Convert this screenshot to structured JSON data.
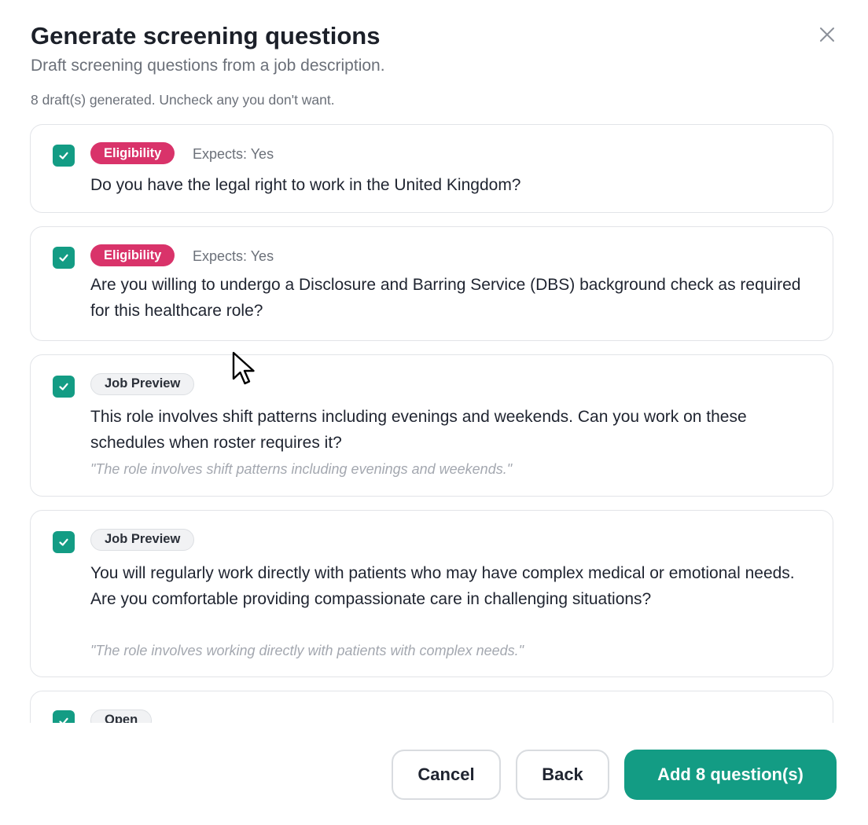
{
  "dialog": {
    "title": "Generate screening questions",
    "subtitle": "Draft screening questions from a job description.",
    "close_icon": "close-icon"
  },
  "summary": "8 draft(s) generated. Uncheck any you don't want.",
  "drafts": [
    {
      "checked": true,
      "category": "Eligibility",
      "expects": "Expects: Yes",
      "question": "Do you have the legal right to work in the United Kingdom?"
    },
    {
      "checked": true,
      "category": "Eligibility",
      "expects": "Expects: Yes",
      "question": "Are you willing to undergo a Disclosure and Barring Service (DBS) background check as required for this healthcare role?"
    },
    {
      "checked": true,
      "category": "Job Preview",
      "question": "This role involves shift patterns including evenings and weekends. Can you work on these schedules when roster requires it?",
      "source_quote": "\"The role involves shift patterns including evenings and weekends.\""
    },
    {
      "checked": true,
      "category": "Job Preview",
      "question": "You will regularly work directly with patients who may have complex medical or emotional needs. Are you comfortable providing compassionate care in challenging situations?",
      "source_quote": "\"The role involves working directly with patients with complex needs.\""
    },
    {
      "checked": true,
      "category": "Open"
    }
  ],
  "footer": {
    "cancel_label": "Cancel",
    "back_label": "Back",
    "add_label": "Add 8 question(s)"
  },
  "colors": {
    "accent": "#139c84",
    "eligibility_badge": "#d9336a"
  }
}
